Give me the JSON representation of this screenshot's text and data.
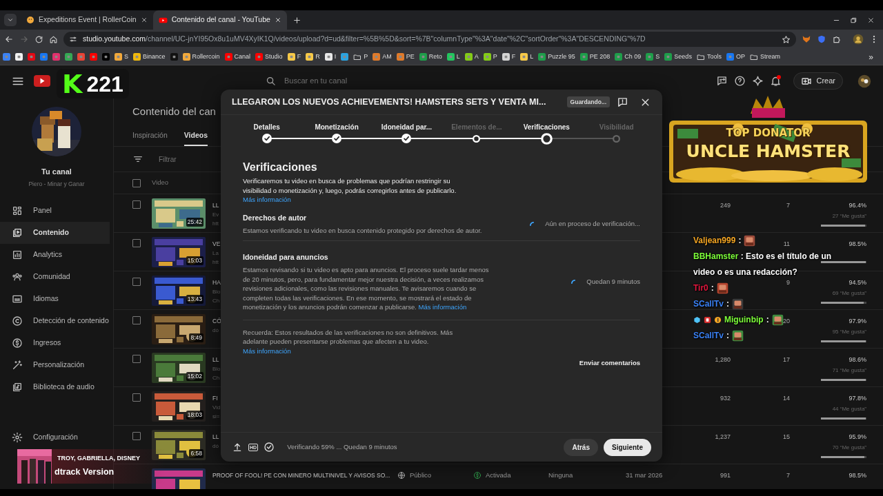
{
  "browser": {
    "tabs": [
      {
        "title": "Expeditions Event | RollerCoin",
        "selected": false
      },
      {
        "title": "Contenido del canal - YouTube",
        "selected": true
      }
    ],
    "url_host": "studio.youtube.com",
    "url_path": "/channel/UC-jnYI95Ox8u1uMV4XyIK1Q/videos/upload?d=ud&filter=%5B%5D&sort=%7B\"columnType\"%3A\"date\"%2C\"sortOrder\"%3A\"DESCENDING\"%7D",
    "bookmarks": [
      {
        "kind": "site",
        "color": "#3b82f6"
      },
      {
        "kind": "site",
        "color": "#f1f1f1"
      },
      {
        "kind": "site",
        "color": "#e50914"
      },
      {
        "kind": "site",
        "color": "#1877f2"
      },
      {
        "kind": "site",
        "color": "#e1306c"
      },
      {
        "kind": "site",
        "color": "#34a853"
      },
      {
        "kind": "site",
        "color": "#ea4335"
      },
      {
        "kind": "site",
        "color": "#ff0000"
      },
      {
        "kind": "site",
        "color": "#000000"
      },
      {
        "kind": "site",
        "color": "#f2a93b",
        "label": "S"
      },
      {
        "kind": "site",
        "color": "#f0b90b",
        "label": "Binance"
      },
      {
        "kind": "site",
        "color": "#111111"
      },
      {
        "kind": "site",
        "color": "#f2a93b",
        "label": "Rollercoin"
      },
      {
        "kind": "site",
        "color": "#ff0000",
        "label": "Canal"
      },
      {
        "kind": "site",
        "color": "#ff0000",
        "label": "Studio"
      },
      {
        "kind": "site",
        "color": "#f7c948",
        "label": "F"
      },
      {
        "kind": "site",
        "color": "#f7c948",
        "label": "R"
      },
      {
        "kind": "site",
        "color": "#e8e8e8",
        "label": "I"
      },
      {
        "kind": "site",
        "color": "#2aa3e0"
      },
      {
        "kind": "folder",
        "label": "P"
      },
      {
        "kind": "site",
        "color": "#e07a2a",
        "label": "AM"
      },
      {
        "kind": "site",
        "color": "#e07a2a",
        "label": "PE"
      },
      {
        "kind": "site",
        "color": "#1e9e4a",
        "label": "Reto"
      },
      {
        "kind": "site",
        "color": "#22c55e",
        "label": "L"
      },
      {
        "kind": "site",
        "color": "#84cc16",
        "label": "A"
      },
      {
        "kind": "site",
        "color": "#84cc16",
        "label": "P"
      },
      {
        "kind": "site",
        "color": "#d4d4d4",
        "label": "F"
      },
      {
        "kind": "site",
        "color": "#f7c948",
        "label": "L"
      },
      {
        "kind": "site",
        "color": "#1e9e4a",
        "label": "Puzzle 95"
      },
      {
        "kind": "site",
        "color": "#1e9e4a",
        "label": "PE 208"
      },
      {
        "kind": "site",
        "color": "#1e9e4a",
        "label": "Ch 09"
      },
      {
        "kind": "site",
        "color": "#1e9e4a",
        "label": "S"
      },
      {
        "kind": "site",
        "color": "#1e9e4a",
        "label": "Seeds"
      },
      {
        "kind": "folder",
        "label": "Tools"
      },
      {
        "kind": "site",
        "color": "#1877f2",
        "label": "OP"
      },
      {
        "kind": "folder",
        "label": "Stream"
      }
    ],
    "more": "»"
  },
  "header": {
    "search_placeholder": "Buscar en tu canal",
    "has_notification": true,
    "create_label": "Crear"
  },
  "sidebar": {
    "channel_title": "Tu canal",
    "channel_subtitle": "Piero - Minar y Ganar",
    "items": [
      {
        "label": "Panel",
        "selected": false
      },
      {
        "label": "Contenido",
        "selected": true
      },
      {
        "label": "Analytics",
        "selected": false
      },
      {
        "label": "Comunidad",
        "selected": false
      },
      {
        "label": "Idiomas",
        "selected": false
      },
      {
        "label": "Detección de contenido",
        "selected": false
      },
      {
        "label": "Ingresos",
        "selected": false
      },
      {
        "label": "Personalización",
        "selected": false
      },
      {
        "label": "Biblioteca de audio",
        "selected": false
      }
    ],
    "settings_label": "Configuración"
  },
  "content": {
    "title": "Contenido del can",
    "tabs": [
      {
        "label": "Inspiración",
        "selected": false
      },
      {
        "label": "Videos",
        "selected": true
      }
    ],
    "filter_placeholder": "Filtrar",
    "column_video": "Video",
    "select_all_checked": false,
    "rows": [
      {
        "checked": false,
        "duration": "25:42",
        "title": "LL",
        "description": [
          "Ev",
          "htt"
        ],
        "views": "249",
        "comments": "7",
        "likes_pct": "96.4%",
        "likes_count": "27 “Me gusta”",
        "level": 0.964
      },
      {
        "checked": false,
        "duration": "15:03",
        "title": "VE",
        "description": [
          "La",
          "htt"
        ],
        "comments": "11",
        "likes_pct": "98.5%",
        "level": 0.985
      },
      {
        "checked": false,
        "duration": "13:43",
        "title": "HA",
        "description": [
          "Blo",
          "Ch"
        ],
        "comments": "9",
        "likes_pct": "94.5%",
        "likes_count": "69 “Me gusta”",
        "level": 0.945
      },
      {
        "checked": false,
        "duration": "8:49",
        "title": "CÓ",
        "description": [
          "dó"
        ],
        "comments": "20",
        "likes_pct": "97.9%",
        "likes_count": "95 “Me gusta”",
        "level": 0.979
      },
      {
        "checked": false,
        "duration": "15:02",
        "title": "LL",
        "description": [
          "Blo",
          "Ch"
        ],
        "views": "1,280",
        "comments": "17",
        "likes_pct": "98.6%",
        "likes_count": "71 “Me gusta”",
        "level": 0.986
      },
      {
        "checked": false,
        "duration": "18:03",
        "title": "FI",
        "description": [
          "Vid",
          "si="
        ],
        "views": "932",
        "comments": "14",
        "likes_pct": "97.8%",
        "likes_count": "44 “Me gusta”",
        "level": 0.978
      },
      {
        "checked": false,
        "duration": "6:58",
        "title": "LL",
        "description": [
          "dó"
        ],
        "views": "1,237",
        "comments": "15",
        "likes_pct": "95.9%",
        "likes_count": "70 “Me gusta”",
        "level": 0.959
      },
      {
        "title": "PROOF OF FOOL! PE CON MINERO MULTINIVEL Y AVISOS SO...",
        "visibility": "Público",
        "monetization": "Activada",
        "restrictions": "Ninguna",
        "date": "31 mar 2026",
        "views": "991",
        "comments": "7",
        "likes_pct": "98.5%"
      }
    ]
  },
  "modal": {
    "title": "LLEGARON LOS NUEVOS ACHIEVEMENTS! HAMSTERS SETS Y VENTA MI...",
    "save_status": "Guardando...",
    "steps": [
      {
        "label": "Detalles",
        "kind": "done",
        "selected": false
      },
      {
        "label": "Monetización",
        "kind": "done",
        "selected": false
      },
      {
        "label": "Idoneidad par...",
        "kind": "done",
        "selected": false
      },
      {
        "label": "Elementos de...",
        "kind": "open",
        "selected": false
      },
      {
        "label": "Verificaciones",
        "kind": "open",
        "selected": true
      },
      {
        "label": "Visibilidad",
        "kind": "todo",
        "selected": false
      }
    ],
    "heading": "Verificaciones",
    "intro": "Verificaremos tu video en busca de problemas que podrían restringir su visibilidad o monetización y, luego, podrás corregirlos antes de publicarlo.",
    "intro_link": "Más información",
    "checks": [
      {
        "title": "Derechos de autor",
        "description": "Estamos verificando tu video en busca contenido protegido por derechos de autor.",
        "status": "Aún en proceso de verificación..."
      },
      {
        "title": "Idoneidad para anuncios",
        "description": "Estamos revisando si tu video es apto para anuncios. El proceso suele tardar menos de 20 minutos, pero, para fundamentar mejor nuestra decisión, a veces realizamos revisiones adicionales, como las revisiones manuales. Te avisaremos cuando se completen todas las verificaciones. En ese momento, se mostrará el estado de monetización y los anuncios podrán comenzar a publicarse.",
        "link": "Más información",
        "status": "Quedan 9 minutos"
      }
    ],
    "reminder": "Recuerda: Estos resultados de las verificaciones no son definitivos. Más adelante pueden presentarse problemas que afecten a tu video.",
    "reminder_link": "Más información",
    "feedback": "Enviar comentarios",
    "quality_badge": "HD",
    "progress": "Verificando 59% ... Quedan 9 minutos",
    "back": "Atrás",
    "next": "Siguiente"
  },
  "kick_counter": {
    "logo": "K",
    "count": "221"
  },
  "donator_banner": {
    "kicker": "TOP DONATOR",
    "name": "UNCLE HAMSTER"
  },
  "chat": [
    {
      "user": "Valjean999",
      "color": "#f5a623",
      "separator": ":",
      "kind": "emote"
    },
    {
      "user": "BBHamster",
      "color": "#7dff3a",
      "separator": ":",
      "kind": "text",
      "text": "Esto es el título de un video o es una redacción?"
    },
    {
      "user": "Tir0",
      "color": "#e3173e",
      "separator": ":",
      "kind": "emote"
    },
    {
      "user": "SCallTv",
      "color": "#3b82f6",
      "separator": ":",
      "kind": "emote"
    },
    {
      "user": "Miguinbip",
      "color": "#7dff3a",
      "separator": ":",
      "kind": "emote",
      "has_badges": true
    },
    {
      "user": "SCallTv",
      "color": "#3b82f6",
      "separator": ":",
      "kind": "emote"
    }
  ],
  "music": {
    "artists": "TROY, GABRIELLA, DISNEY",
    "title": "dtrack Version"
  }
}
